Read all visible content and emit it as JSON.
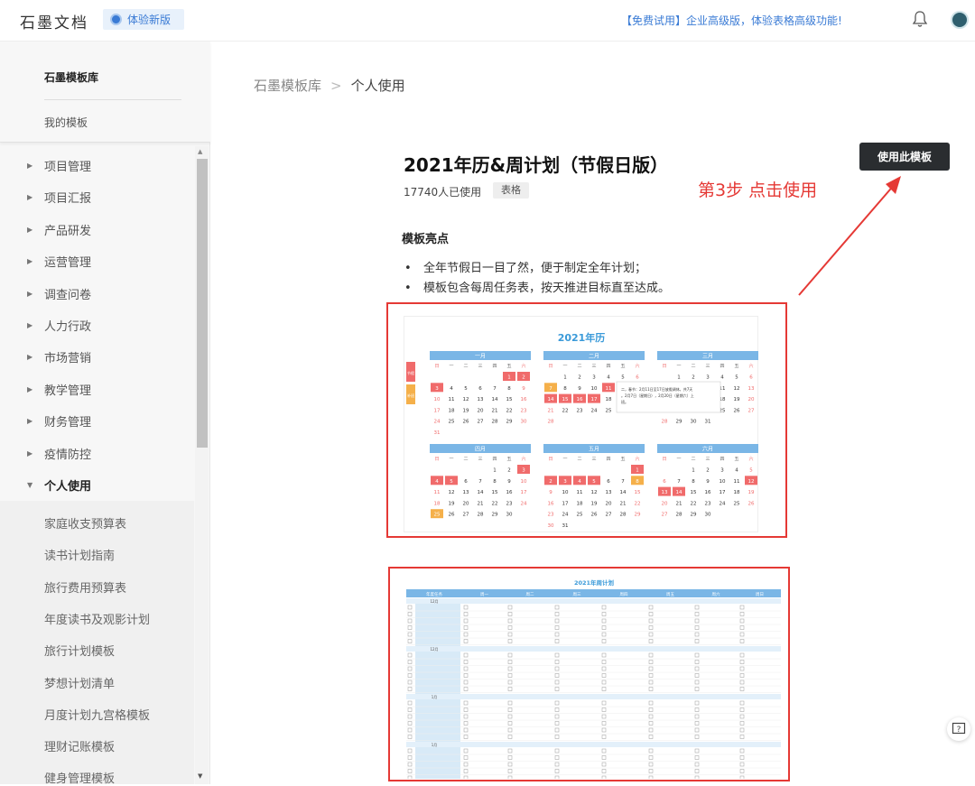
{
  "header": {
    "logo": "石墨文档",
    "beta_label": "体验新版",
    "promo": "【免费试用】企业高级版，体验表格高级功能!"
  },
  "sidebar": {
    "library_title": "石墨模板库",
    "my_templates": "我的模板",
    "categories": [
      "项目管理",
      "项目汇报",
      "产品研发",
      "运营管理",
      "调查问卷",
      "人力行政",
      "市场营销",
      "教学管理",
      "财务管理",
      "疫情防控",
      "个人使用"
    ],
    "sub_items": [
      "家庭收支预算表",
      "读书计划指南",
      "旅行费用预算表",
      "年度读书及观影计划",
      "旅行计划模板",
      "梦想计划清单",
      "月度计划九宫格模板",
      "理财记账模板",
      "健身管理模板"
    ]
  },
  "breadcrumb": {
    "root": "石墨模板库",
    "sep": ">",
    "current": "个人使用"
  },
  "template": {
    "title": "2021年历&周计划（节假日版）",
    "users": "17740人已使用",
    "tag": "表格",
    "use_button": "使用此模板",
    "highlights_title": "模板亮点",
    "highlights": [
      "全年节假日一目了然，便于制定全年计划；",
      "模板包含每周任务表，按天推进目标直至达成。"
    ]
  },
  "annotation": {
    "step_text": "第3步 点击使用",
    "color": "#e53935"
  },
  "preview1": {
    "title": "2021年历",
    "weekday_headers": [
      "日",
      "一",
      "二",
      "三",
      "四",
      "五",
      "六"
    ],
    "side_tags": [
      "节假",
      "补班"
    ],
    "tooltip": "二，春节：2月11日至17日放假调休，共7天。2月7日（星期日），2月20日（星期六）上班。",
    "months": [
      {
        "name": "一月",
        "start": 5,
        "days": 31
      },
      {
        "name": "二月",
        "start": 1,
        "days": 28
      },
      {
        "name": "三月",
        "start": 1,
        "days": 31
      },
      {
        "name": "四月",
        "start": 4,
        "days": 30
      },
      {
        "name": "五月",
        "start": 6,
        "days": 31
      },
      {
        "name": "六月",
        "start": 2,
        "days": 30
      }
    ]
  },
  "preview2": {
    "title": "2021年周计划",
    "columns": [
      "年度任务",
      "周一",
      "周二",
      "周三",
      "周四",
      "周五",
      "周六",
      "周日"
    ],
    "row_groups": [
      "12月",
      "12月",
      "1月",
      "1月"
    ]
  },
  "colors": {
    "accent_blue": "#3a7bd5",
    "month_header": "#7ab6e6",
    "holiday": "#f06b6b",
    "workday": "#f5b04a"
  }
}
